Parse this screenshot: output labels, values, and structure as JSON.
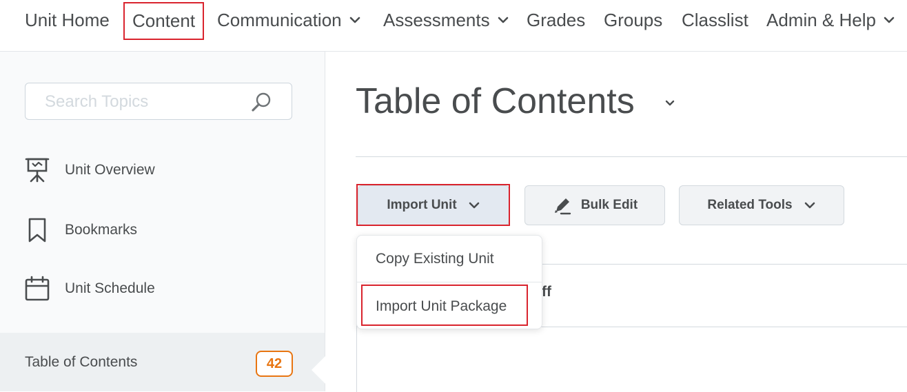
{
  "nav": {
    "items": [
      {
        "label": "Unit Home"
      },
      {
        "label": "Content"
      },
      {
        "label": "Communication"
      },
      {
        "label": "Assessments"
      },
      {
        "label": "Grades"
      },
      {
        "label": "Groups"
      },
      {
        "label": "Classlist"
      },
      {
        "label": "Admin & Help"
      }
    ]
  },
  "sidebar": {
    "search": {
      "placeholder": "Search Topics"
    },
    "items": [
      {
        "label": "Unit Overview",
        "icon": "presentation-icon"
      },
      {
        "label": "Bookmarks",
        "icon": "bookmark-icon"
      },
      {
        "label": "Unit Schedule",
        "icon": "calendar-icon"
      }
    ],
    "toc": {
      "label": "Table of Contents",
      "count": "42"
    }
  },
  "main": {
    "title": "Table of Contents",
    "buttons": {
      "import": "Import Unit",
      "bulk_edit": "Bulk Edit",
      "related_tools": "Related Tools"
    },
    "partial_text": "ff"
  },
  "dropdown": {
    "items": [
      {
        "label": "Copy Existing Unit"
      },
      {
        "label": "Import Unit Package"
      }
    ]
  },
  "colors": {
    "highlight": "#d9232d",
    "badge": "#e87511",
    "text": "#494c4e"
  }
}
